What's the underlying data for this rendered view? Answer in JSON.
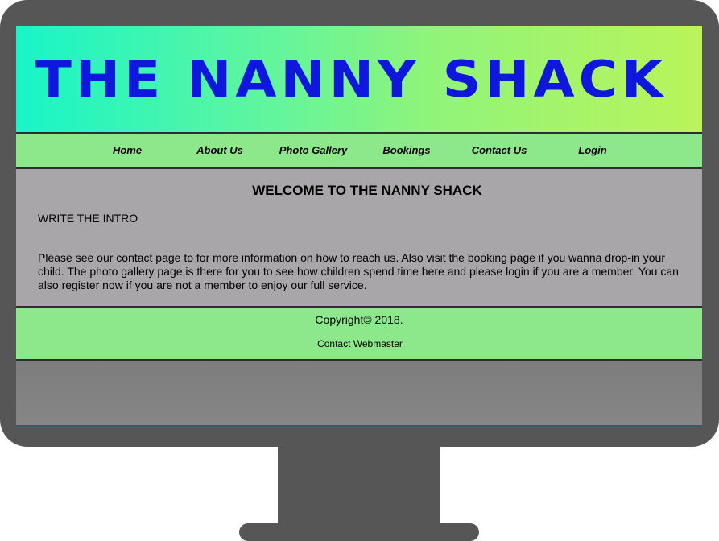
{
  "banner": {
    "title": "THE NANNY SHACK"
  },
  "nav": {
    "items": [
      {
        "label": "Home"
      },
      {
        "label": "About Us"
      },
      {
        "label": "Photo Gallery"
      },
      {
        "label": "Bookings"
      },
      {
        "label": "Contact Us"
      },
      {
        "label": "Login"
      }
    ]
  },
  "main": {
    "heading": "WELCOME TO THE NANNY SHACK",
    "intro": "WRITE THE INTRO",
    "paragraph": "Please see our contact page to for more information on how to reach us. Also visit the booking page if you wanna drop-in your child. The photo gallery page is there for you to see how children spend time here and please login if you are a member. You can also register now if you are not a member to enjoy our full service."
  },
  "footer": {
    "copyright": "Copyright© 2018.",
    "webmaster_link": "Contact Webmaster"
  },
  "colors": {
    "monitor": "#565656",
    "banner_title": "#1017dc",
    "nav_bg": "#8de88c",
    "content_bg": "#a8a6a8"
  }
}
